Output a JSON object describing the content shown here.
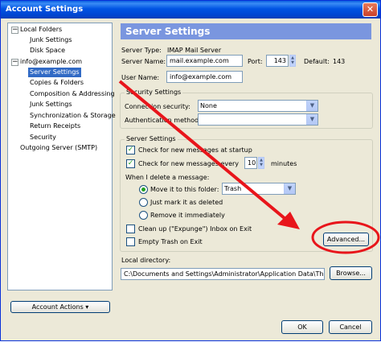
{
  "window": {
    "title": "Account Settings",
    "close_glyph": "✕"
  },
  "tree": {
    "items": [
      {
        "label": "Local Folders"
      },
      {
        "label": "Junk Settings"
      },
      {
        "label": "Disk Space"
      },
      {
        "label": "info@example.com"
      },
      {
        "label": "Server Settings"
      },
      {
        "label": "Copies & Folders"
      },
      {
        "label": "Composition & Addressing"
      },
      {
        "label": "Junk Settings"
      },
      {
        "label": "Synchronization & Storage"
      },
      {
        "label": "Return Receipts"
      },
      {
        "label": "Security"
      },
      {
        "label": "Outgoing Server (SMTP)"
      }
    ],
    "expander_glyph": "−"
  },
  "account_actions": {
    "label": "Account Actions",
    "arrow": "▾"
  },
  "panel": {
    "title": "Server Settings",
    "server_type_label": "Server Type:",
    "server_type_value": "IMAP Mail Server",
    "server_name_label": "Server Name:",
    "server_name_value": "mail.example.com",
    "port_label": "Port:",
    "port_value": "143",
    "default_label": "Default:",
    "default_value": "143",
    "user_name_label": "User Name:",
    "user_name_value": "info@example.com"
  },
  "security": {
    "group_title": "Security Settings",
    "connection_label": "Connection security:",
    "connection_value": "None",
    "auth_label": "Authentication method:",
    "auth_value": ""
  },
  "server_settings": {
    "group_title": "Server Settings",
    "check_startup_label": "Check for new messages at startup",
    "check_every_label": "Check for new messages every",
    "check_every_value": "10",
    "minutes_label": "minutes",
    "delete_label": "When I delete a message:",
    "move_label": "Move it to this folder:",
    "move_folder_value": "Trash",
    "mark_label": "Just mark it as deleted",
    "remove_label": "Remove it immediately",
    "cleanup_label": "Clean up (\"Expunge\") Inbox on Exit",
    "empty_trash_label": "Empty Trash on Exit",
    "advanced_label": "Advanced..."
  },
  "local_dir": {
    "label": "Local directory:",
    "value": "C:\\Documents and Settings\\Administrator\\Application Data\\Thunderb",
    "browse_label": "Browse..."
  },
  "footer": {
    "ok_label": "OK",
    "cancel_label": "Cancel"
  },
  "glyphs": {
    "check": "✓",
    "dropdown": "▼",
    "spin_up": "▲",
    "spin_down": "▼"
  },
  "annotation_color": "#e8151b"
}
